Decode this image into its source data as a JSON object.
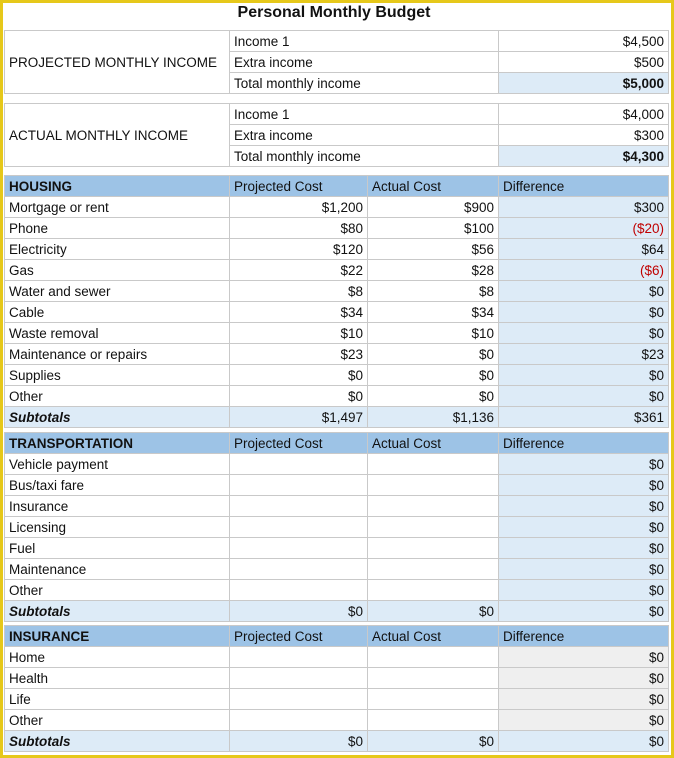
{
  "title": "Personal Monthly Budget",
  "projected_income": {
    "label": "PROJECTED MONTHLY INCOME",
    "rows": [
      {
        "name": "Income 1",
        "value": "$4,500"
      },
      {
        "name": "Extra income",
        "value": "$500"
      },
      {
        "name": "Total monthly income",
        "value": "$5,000"
      }
    ]
  },
  "actual_income": {
    "label": "ACTUAL MONTHLY INCOME",
    "rows": [
      {
        "name": "Income 1",
        "value": "$4,000"
      },
      {
        "name": "Extra income",
        "value": "$300"
      },
      {
        "name": "Total monthly income",
        "value": "$4,300"
      }
    ]
  },
  "columns": {
    "projected": "Projected Cost",
    "actual": "Actual Cost",
    "difference": "Difference"
  },
  "housing": {
    "title": "HOUSING",
    "rows": [
      {
        "item": "Mortgage or rent",
        "projected": "$1,200",
        "actual": "$900",
        "difference": "$300"
      },
      {
        "item": "Phone",
        "projected": "$80",
        "actual": "$100",
        "difference": "($20)"
      },
      {
        "item": "Electricity",
        "projected": "$120",
        "actual": "$56",
        "difference": "$64"
      },
      {
        "item": "Gas",
        "projected": "$22",
        "actual": "$28",
        "difference": "($6)"
      },
      {
        "item": "Water and sewer",
        "projected": "$8",
        "actual": "$8",
        "difference": "$0"
      },
      {
        "item": "Cable",
        "projected": "$34",
        "actual": "$34",
        "difference": "$0"
      },
      {
        "item": "Waste removal",
        "projected": "$10",
        "actual": "$10",
        "difference": "$0"
      },
      {
        "item": "Maintenance or repairs",
        "projected": "$23",
        "actual": "$0",
        "difference": "$23"
      },
      {
        "item": "Supplies",
        "projected": "$0",
        "actual": "$0",
        "difference": "$0"
      },
      {
        "item": "Other",
        "projected": "$0",
        "actual": "$0",
        "difference": "$0"
      }
    ],
    "subtotal": {
      "label": "Subtotals",
      "projected": "$1,497",
      "actual": "$1,136",
      "difference": "$361"
    }
  },
  "transportation": {
    "title": "TRANSPORTATION",
    "rows": [
      {
        "item": "Vehicle payment",
        "projected": "",
        "actual": "",
        "difference": "$0"
      },
      {
        "item": "Bus/taxi fare",
        "projected": "",
        "actual": "",
        "difference": "$0"
      },
      {
        "item": "Insurance",
        "projected": "",
        "actual": "",
        "difference": "$0"
      },
      {
        "item": "Licensing",
        "projected": "",
        "actual": "",
        "difference": "$0"
      },
      {
        "item": "Fuel",
        "projected": "",
        "actual": "",
        "difference": "$0"
      },
      {
        "item": "Maintenance",
        "projected": "",
        "actual": "",
        "difference": "$0"
      },
      {
        "item": "Other",
        "projected": "",
        "actual": "",
        "difference": "$0"
      }
    ],
    "subtotal": {
      "label": "Subtotals",
      "projected": "$0",
      "actual": "$0",
      "difference": "$0"
    }
  },
  "insurance": {
    "title": "INSURANCE",
    "rows": [
      {
        "item": "Home",
        "projected": "",
        "actual": "",
        "difference": "$0"
      },
      {
        "item": "Health",
        "projected": "",
        "actual": "",
        "difference": "$0"
      },
      {
        "item": "Life",
        "projected": "",
        "actual": "",
        "difference": "$0"
      },
      {
        "item": "Other",
        "projected": "",
        "actual": "",
        "difference": "$0"
      }
    ],
    "subtotal": {
      "label": "Subtotals",
      "projected": "$0",
      "actual": "$0",
      "difference": "$0"
    }
  },
  "colors": {
    "header": "#9dc3e6",
    "light_fill": "#ddebf7",
    "negative": "#c00000",
    "frame": "#e6c81a"
  }
}
